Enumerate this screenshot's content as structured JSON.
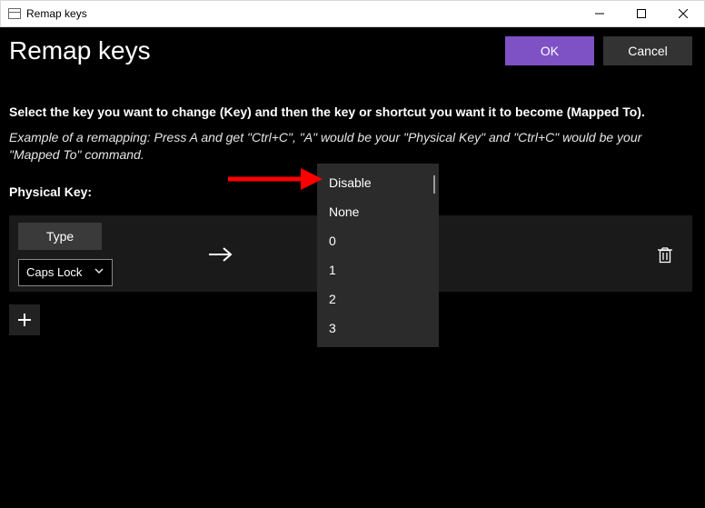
{
  "window": {
    "title": "Remap keys"
  },
  "header": {
    "heading": "Remap keys",
    "ok_label": "OK",
    "cancel_label": "Cancel"
  },
  "text": {
    "instruction": "Select the key you want to change (Key) and then the key or shortcut you want it to become (Mapped To).",
    "example": "Example of a remapping: Press A and get \"Ctrl+C\", \"A\" would be your \"Physical Key\" and \"Ctrl+C\" would be your \"Mapped To\" command.",
    "physical_key_label": "Physical Key:"
  },
  "row": {
    "type_label": "Type",
    "selected_key": "Caps Lock"
  },
  "dropdown": {
    "options": [
      "Disable",
      "None",
      "0",
      "1",
      "2",
      "3"
    ]
  },
  "icons": {
    "minimize": "minimize",
    "maximize": "maximize",
    "close": "close",
    "chevron_down": "⌄",
    "arrow_right": "→",
    "trash": "trash",
    "plus": "+"
  }
}
